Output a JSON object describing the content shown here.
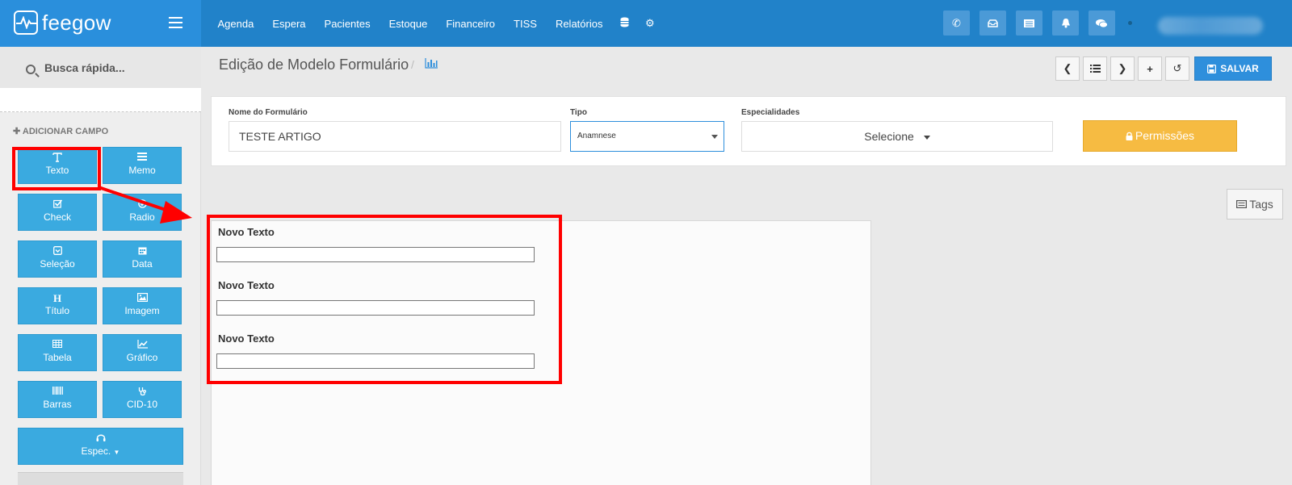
{
  "brand": {
    "name": "feegow"
  },
  "nav": {
    "items": [
      "Agenda",
      "Espera",
      "Pacientes",
      "Estoque",
      "Financeiro",
      "TISS",
      "Relatórios"
    ],
    "extra_icons": [
      "database-icon",
      "gear-icon"
    ]
  },
  "topbar_buttons": [
    "phone-icon",
    "inbox-icon",
    "list-icon",
    "bell-icon",
    "chat-icon"
  ],
  "sidebar": {
    "search_placeholder": "Busca rápida...",
    "add_field_label": "ADICIONAR CAMPO",
    "fields": [
      {
        "label": "Texto",
        "icon": "text-icon"
      },
      {
        "label": "Memo",
        "icon": "memo-icon"
      },
      {
        "label": "Check",
        "icon": "check-icon"
      },
      {
        "label": "Radio",
        "icon": "radio-icon"
      },
      {
        "label": "Seleção",
        "icon": "select-icon"
      },
      {
        "label": "Data",
        "icon": "calendar-icon"
      },
      {
        "label": "Título",
        "icon": "heading-icon"
      },
      {
        "label": "Imagem",
        "icon": "image-icon"
      },
      {
        "label": "Tabela",
        "icon": "table-icon"
      },
      {
        "label": "Gráfico",
        "icon": "chart-icon"
      },
      {
        "label": "Barras",
        "icon": "barcode-icon"
      },
      {
        "label": "CID-10",
        "icon": "stethoscope-icon"
      },
      {
        "label": "Espec.",
        "icon": "headset-icon"
      }
    ]
  },
  "page": {
    "title": "Edição de Modelo Formulário",
    "separator": "/",
    "save_label": "SALVAR"
  },
  "form": {
    "name_label": "Nome do Formulário",
    "name_value": "TESTE ARTIGO",
    "type_label": "Tipo",
    "type_value": "Anamnese",
    "spec_label": "Especialidades",
    "spec_value": "Selecione",
    "permissions_label": "Permissões"
  },
  "tags_label": "Tags",
  "canvas_fields": [
    {
      "label": "Novo Texto"
    },
    {
      "label": "Novo Texto"
    },
    {
      "label": "Novo Texto"
    }
  ],
  "colors": {
    "topbar": "#2182c9",
    "brand": "#2a8fdc",
    "field_button": "#3aaae0",
    "save": "#2e8fdc",
    "permissions": "#f6bb42",
    "annotation": "#ff0000"
  }
}
